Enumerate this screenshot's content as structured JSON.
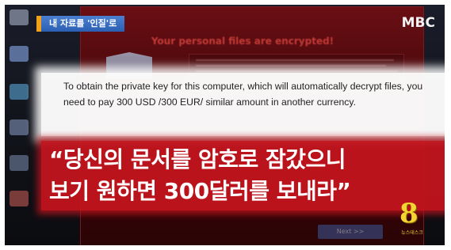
{
  "headline_tag": "내 자료를 '인질'로",
  "broadcaster_logo": "MBC",
  "ransom_window": {
    "title": "Your personal files are encrypted!",
    "next_button": "Next >>"
  },
  "english_quote": "To obtain the private key for this computer, which will automatically decrypt files, you need to pay 300 USD /300 EUR/ similar amount in another currency.",
  "korean_caption": {
    "line1": "“당신의 문서를 암호로 잠갔으니",
    "line2": "보기 원하면 300달러를 보내라”"
  },
  "channel_logo": {
    "number": "8",
    "subtitle": "뉴스데스크"
  },
  "colors": {
    "caption_red": "#c4141e",
    "headline_blue": "#2b5fb3",
    "accent_orange": "#f2a21a",
    "channel_gold": "#f4d430"
  }
}
